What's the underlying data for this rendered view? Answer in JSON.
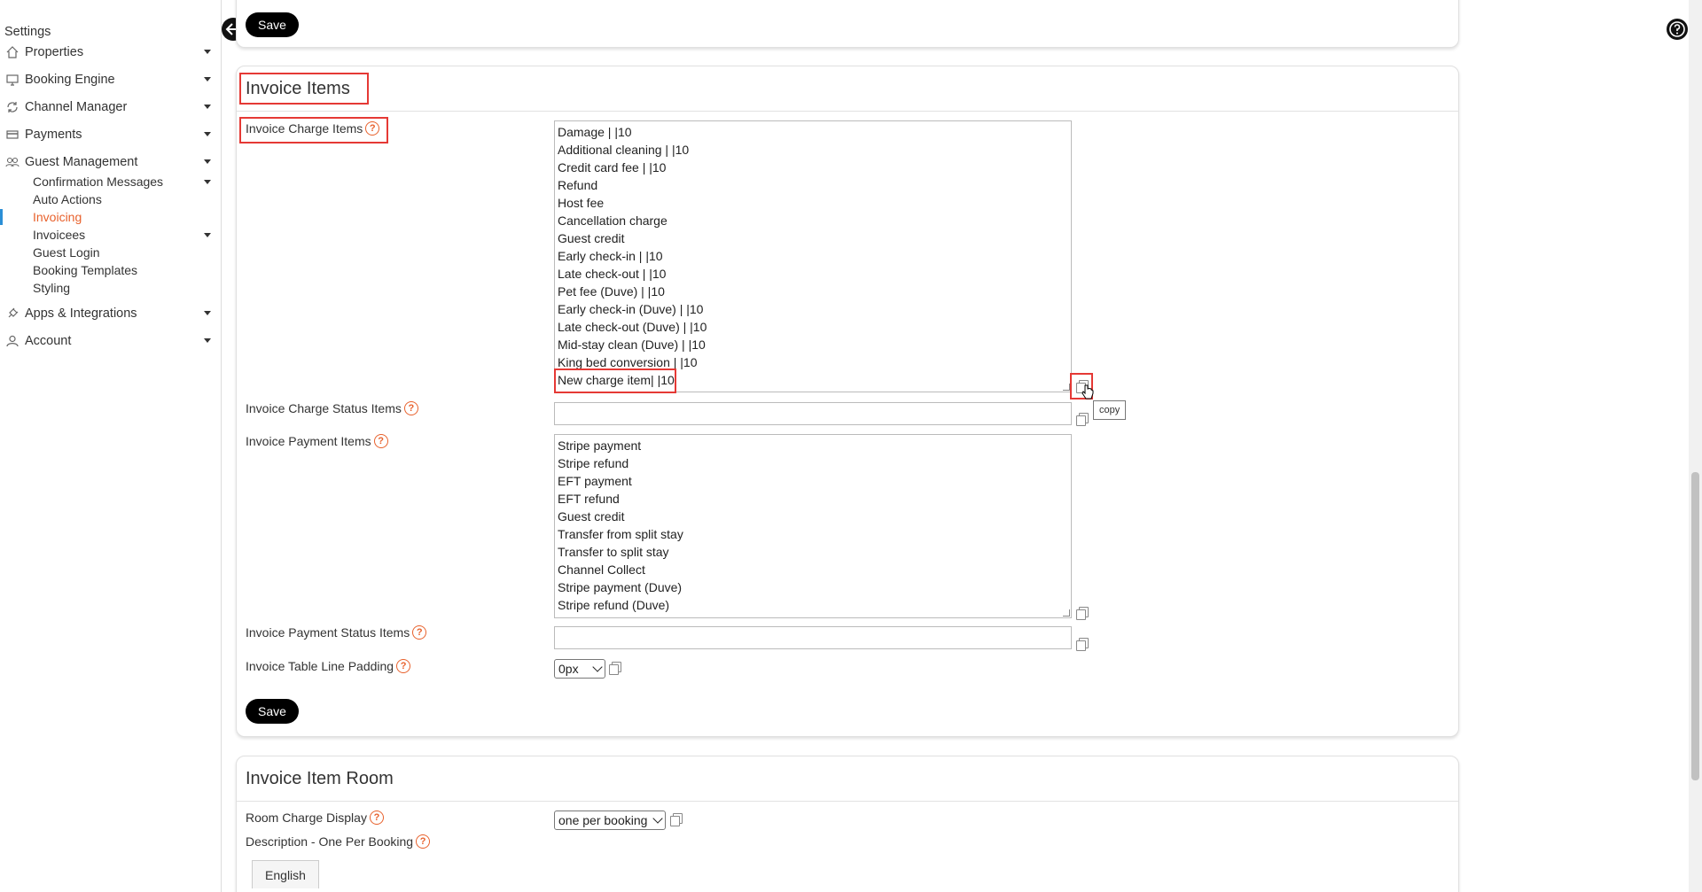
{
  "sidebar": {
    "title": "Settings",
    "items": [
      {
        "label": "Properties",
        "icon": "home-icon"
      },
      {
        "label": "Booking Engine",
        "icon": "monitor-icon"
      },
      {
        "label": "Channel Manager",
        "icon": "sync-icon"
      },
      {
        "label": "Payments",
        "icon": "card-icon"
      },
      {
        "label": "Guest Management",
        "icon": "users-icon"
      }
    ],
    "sub_items": [
      {
        "label": "Confirmation Messages"
      },
      {
        "label": "Auto Actions"
      },
      {
        "label": "Invoicing"
      },
      {
        "label": "Invoicees"
      },
      {
        "label": "Guest Login"
      },
      {
        "label": "Booking Templates"
      },
      {
        "label": "Styling"
      }
    ],
    "bottom_items": [
      {
        "label": "Apps & Integrations",
        "icon": "plug-icon"
      },
      {
        "label": "Account",
        "icon": "user-icon"
      }
    ]
  },
  "top_card": {
    "save_label": "Save"
  },
  "invoice_items": {
    "title": "Invoice Items",
    "charge_items_label": "Invoice Charge Items",
    "charge_items": [
      "Damage | |10",
      "Additional cleaning | |10",
      "Credit card fee | |10",
      "Refund",
      "Host fee",
      "Cancellation charge",
      "Guest credit",
      "Early check-in | |10",
      "Late check-out | |10",
      "Pet fee (Duve) | |10",
      "Early check-in (Duve) | |10",
      "Late check-out (Duve) | |10",
      "Mid-stay clean (Duve) | |10",
      "King bed conversion | |10",
      "New charge item| |10"
    ],
    "charge_status_label": "Invoice Charge Status Items",
    "charge_status_value": "",
    "payment_items_label": "Invoice Payment Items",
    "payment_items": [
      "Stripe payment",
      "Stripe refund",
      "EFT payment",
      "EFT refund",
      "Guest credit",
      "Transfer from split stay",
      "Transfer to split stay",
      "Channel Collect",
      "Stripe payment (Duve)",
      "Stripe refund (Duve)"
    ],
    "payment_status_label": "Invoice Payment Status Items",
    "payment_status_value": "",
    "padding_label": "Invoice Table Line Padding",
    "padding_value": "0px",
    "copy_tooltip": "copy",
    "save_label": "Save"
  },
  "invoice_room": {
    "title": "Invoice Item Room",
    "room_display_label": "Room Charge Display",
    "room_display_value": "one per booking",
    "description_label": "Description - One Per Booking",
    "language_tab": "English"
  },
  "colors": {
    "accent": "#e8612c",
    "highlight": "#e53935",
    "active_bar": "#2b8fd6"
  }
}
